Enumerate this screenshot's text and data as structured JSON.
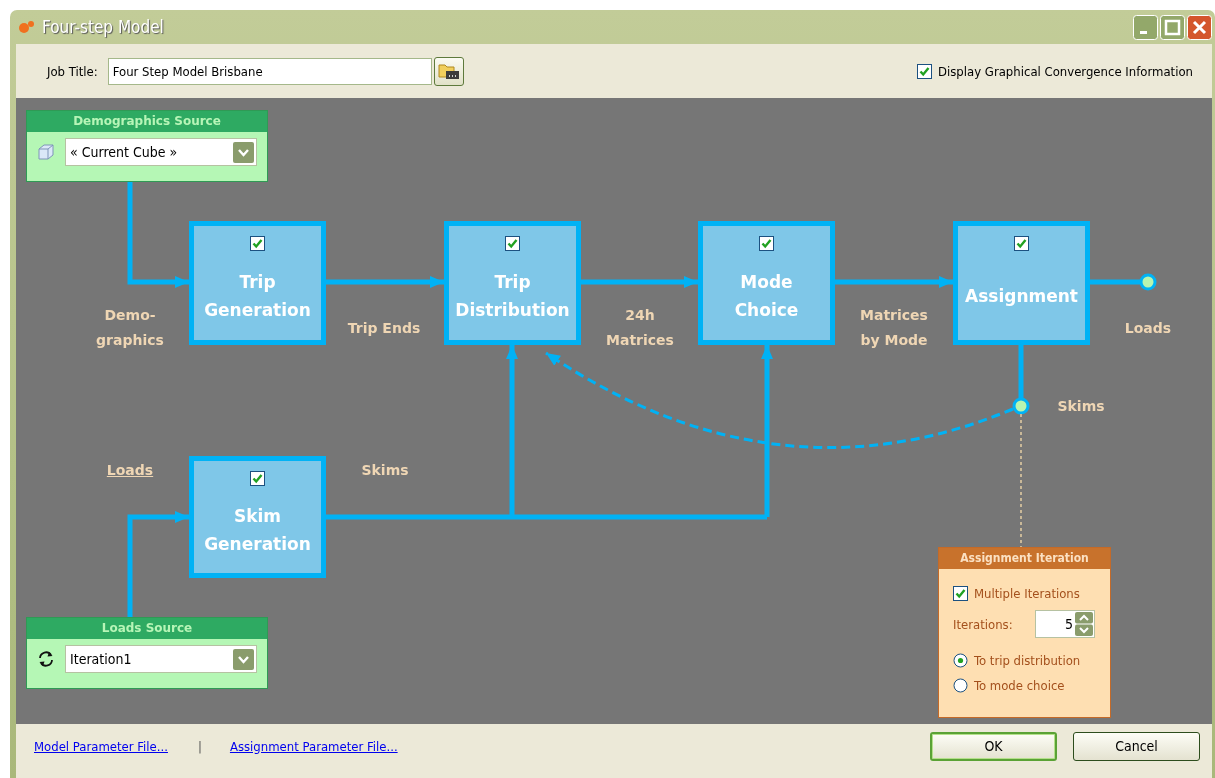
{
  "window": {
    "title": "Four-step Model"
  },
  "toolbar": {
    "job_title_label": "Job Title:",
    "job_title_value": "Four Step Model Brisbane",
    "display_convergence": {
      "label": "Display Graphical Convergence Information",
      "checked": true
    }
  },
  "diagram": {
    "sources": [
      {
        "kind": "demographics",
        "title": "Demographics Source",
        "value": "« Current Cube »"
      },
      {
        "kind": "loads",
        "title": "Loads Source",
        "value": "Iteration1"
      }
    ],
    "steps": [
      {
        "label": "Trip\nGeneration",
        "checked": true
      },
      {
        "label": "Trip\nDistribution",
        "checked": true
      },
      {
        "label": "Mode\nChoice",
        "checked": true
      },
      {
        "label": "Assignment",
        "checked": true
      },
      {
        "label": "Skim\nGeneration",
        "checked": true
      }
    ],
    "flow_labels": [
      {
        "kind": "text",
        "text": "Demo-\ngraphics"
      },
      {
        "kind": "text",
        "text": "Trip Ends"
      },
      {
        "kind": "text",
        "text": "24h\nMatrices"
      },
      {
        "kind": "text",
        "text": "Matrices\nby Mode"
      },
      {
        "kind": "text",
        "text": "Loads"
      },
      {
        "kind": "text",
        "text": "Skims"
      },
      {
        "kind": "link",
        "text": "Loads"
      },
      {
        "kind": "text",
        "text": "Skims"
      }
    ],
    "assignment_iteration": {
      "title": "Assignment Iteration",
      "multiple": {
        "label": "Multiple Iterations",
        "checked": true
      },
      "iterations_label": "Iterations:",
      "iterations_value": "5",
      "targets": [
        {
          "label": "To trip distribution",
          "selected": true
        },
        {
          "label": "To mode choice",
          "selected": false
        }
      ]
    }
  },
  "footer": {
    "links": [
      "Model Parameter File...",
      "Assignment Parameter File..."
    ],
    "separator": "|",
    "buttons": [
      "OK",
      "Cancel"
    ]
  }
}
